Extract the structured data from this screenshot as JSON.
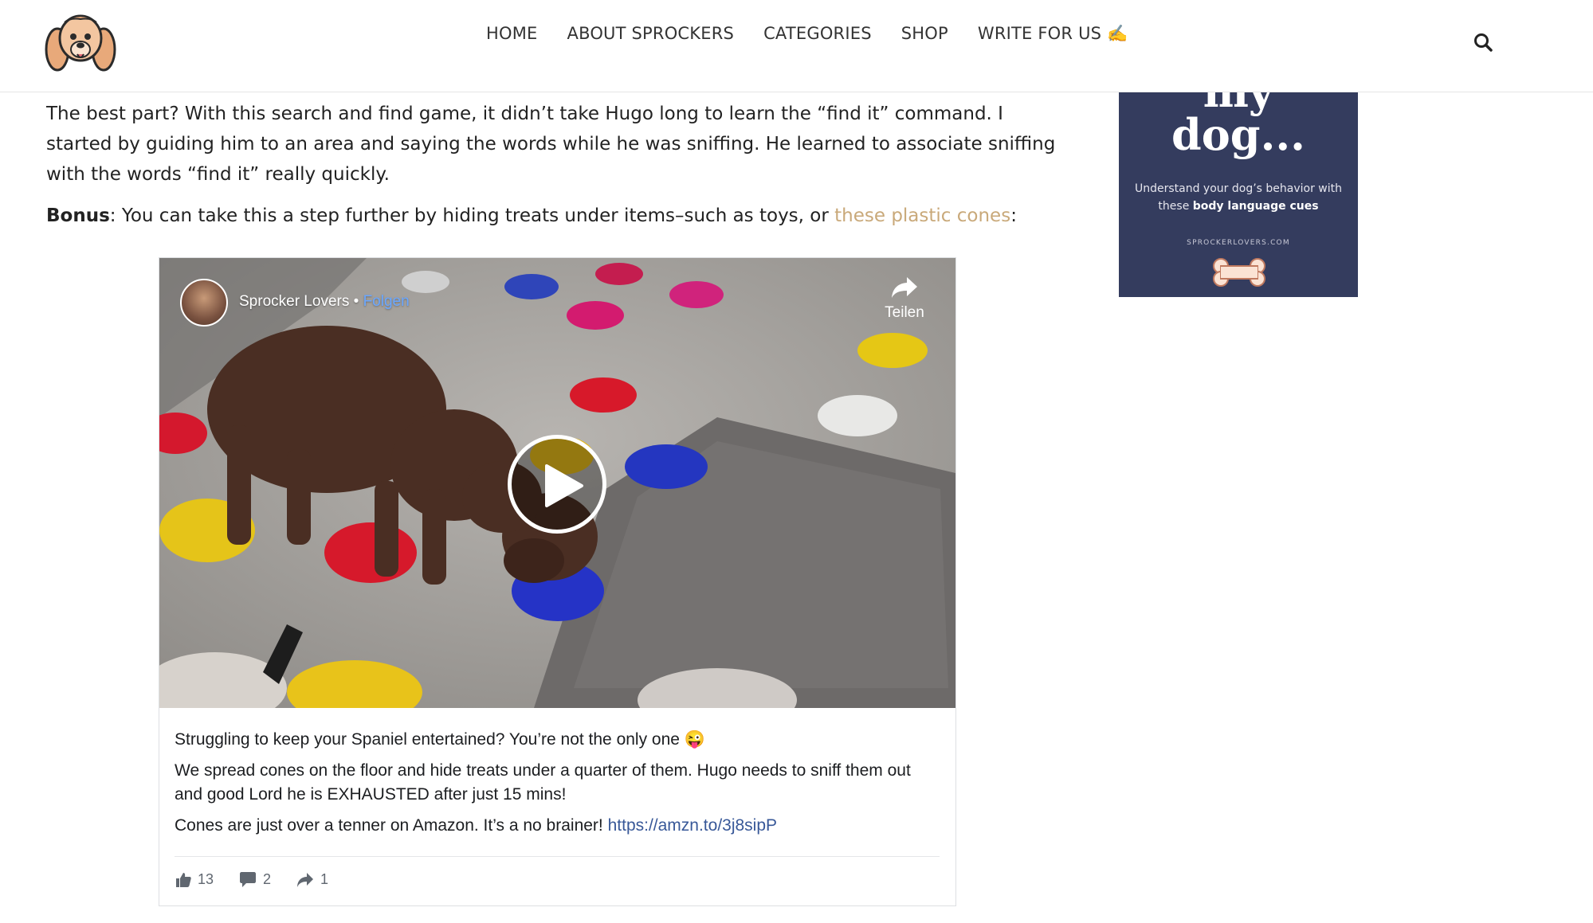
{
  "header": {
    "nav": [
      {
        "label": "HOME"
      },
      {
        "label": "ABOUT SPROCKERS"
      },
      {
        "label": "CATEGORIES"
      },
      {
        "label": "SHOP"
      },
      {
        "label": "WRITE FOR US ✍️"
      }
    ],
    "search_icon": "search-icon",
    "logo_icon": "spaniel-dog-logo"
  },
  "article": {
    "paragraph1": "The best part? With this search and find game, it didn’t take Hugo long to learn the “find it” command. I started by guiding him to an area and saying the words while he was sniffing. He learned to associate sniffing with the words “find it” really quickly.",
    "bonus_label": "Bonus",
    "bonus_text": ": You can take this a step further by hiding treats under items–such as toys, or ",
    "bonus_link": "these plastic cones",
    "bonus_end": ":"
  },
  "sidebar_ad": {
    "title_line1": "my",
    "title_line2": "dog...",
    "subtitle_pre": "Understand your dog’s behavior with these ",
    "subtitle_bold": "body language cues",
    "site": "SPROCKERLOVERS.COM",
    "bg_color": "#343c5e"
  },
  "embed": {
    "page_name": "Sprocker Lovers",
    "separator": " • ",
    "follow_label": "Folgen",
    "share_label": "Teilen",
    "caption1": "Struggling to keep your Spaniel entertained? You’re not the only one 😜",
    "caption2": "We spread cones on the floor and hide treats under a quarter of them. Hugo needs to sniff them out and good Lord he is EXHAUSTED after just 15 mins!",
    "caption3": "Cones are just over a tenner on Amazon. It’s a no brainer! ",
    "caption_link": "https://amzn.to/3j8sipP",
    "likes": "13",
    "comments": "2",
    "shares": "1"
  }
}
